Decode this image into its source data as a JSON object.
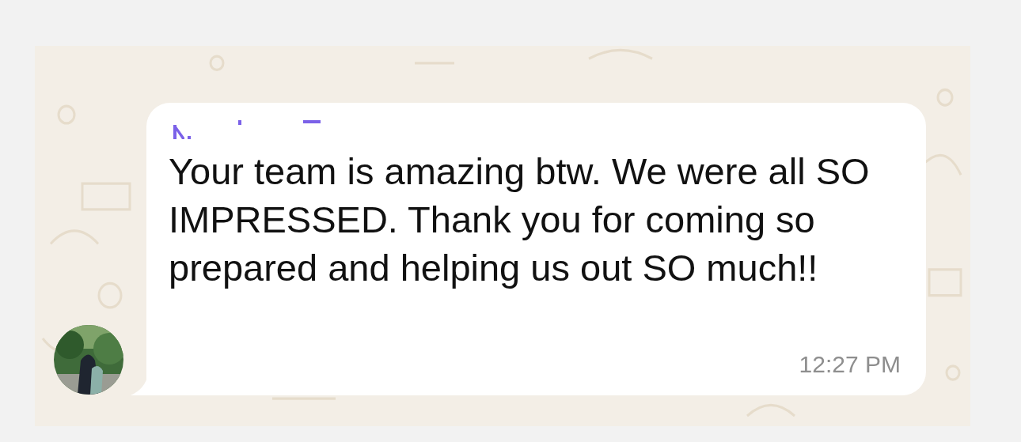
{
  "message": {
    "sender_redacted": true,
    "text": "Your team is amazing btw. We were all SO IMPRESSED. Thank you for coming so prepared and helping us out SO much!!",
    "time": "12:27 PM"
  }
}
